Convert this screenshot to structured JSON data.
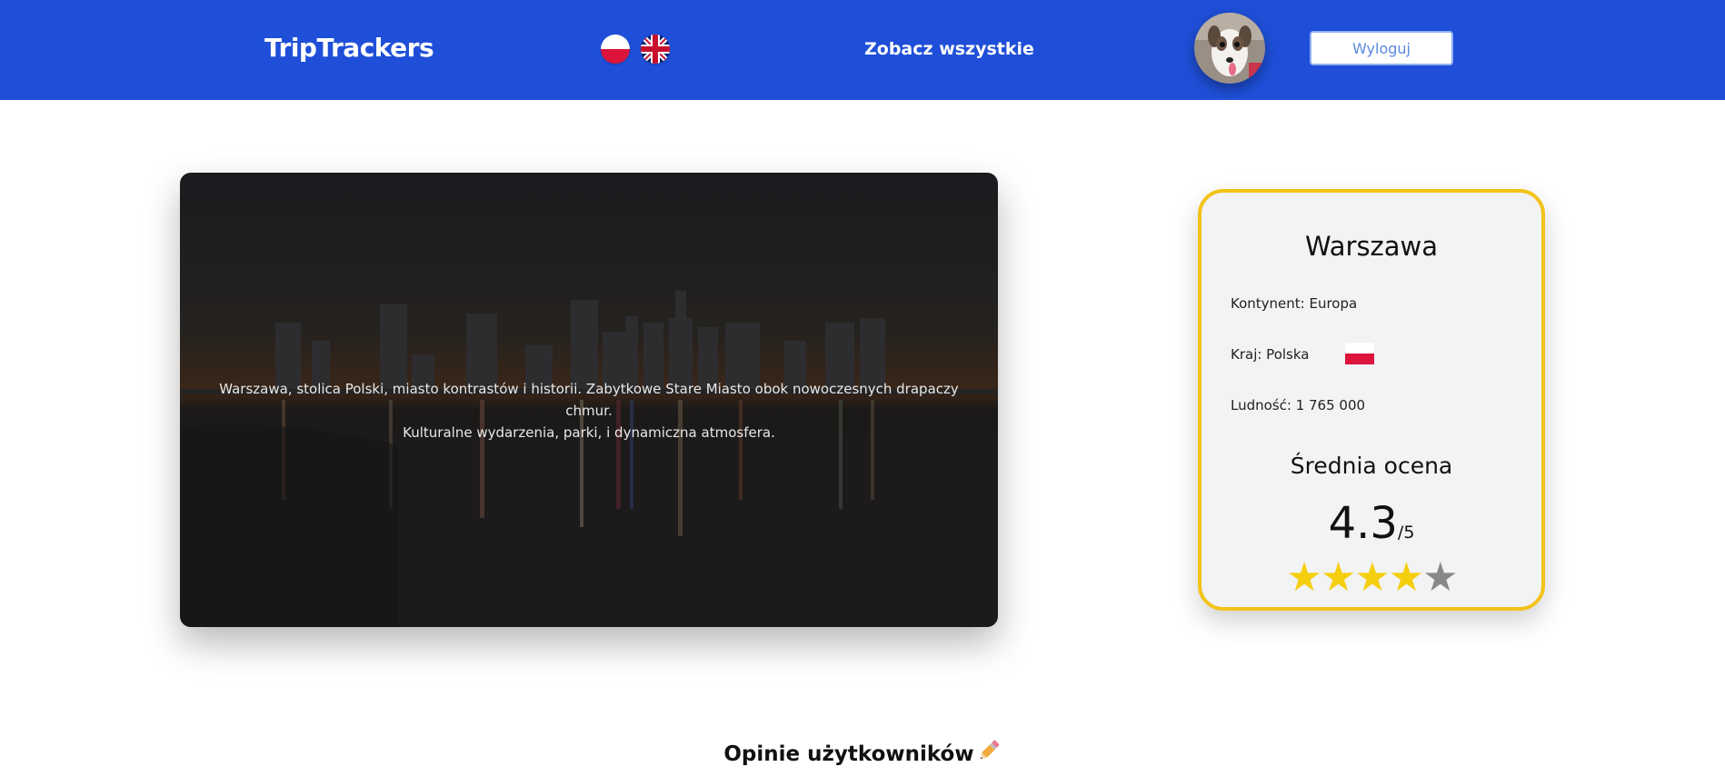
{
  "header": {
    "logo": "TripTrackers",
    "lang_pl": "pl-flag-icon",
    "lang_en": "uk-flag-icon",
    "see_all": "Zobacz wszystkie",
    "avatar": "avatar-dog",
    "logout": "Wyloguj"
  },
  "hero": {
    "description_line1": "Warszawa, stolica Polski, miasto kontrastów i historii. Zabytkowe Stare Miasto obok nowoczesnych drapaczy chmur.",
    "description_line2": "Kulturalne wydarzenia, parki, i dynamiczna atmosfera."
  },
  "card": {
    "city": "Warszawa",
    "continent": "Kontynent: Europa",
    "country": "Kraj: Polska",
    "population": "Ludność: 1 765 000",
    "avg_title": "Średnia ocena",
    "score": "4.3",
    "score_max": "/5",
    "rating_value": 4,
    "rating_max": 5,
    "colors": {
      "border": "#f2c318",
      "star": "#f5cf0f",
      "star_empty": "#888888"
    }
  },
  "opinions": {
    "title": "Opinie użytkowników"
  },
  "colors": {
    "header_bg": "#1f4fd8"
  }
}
